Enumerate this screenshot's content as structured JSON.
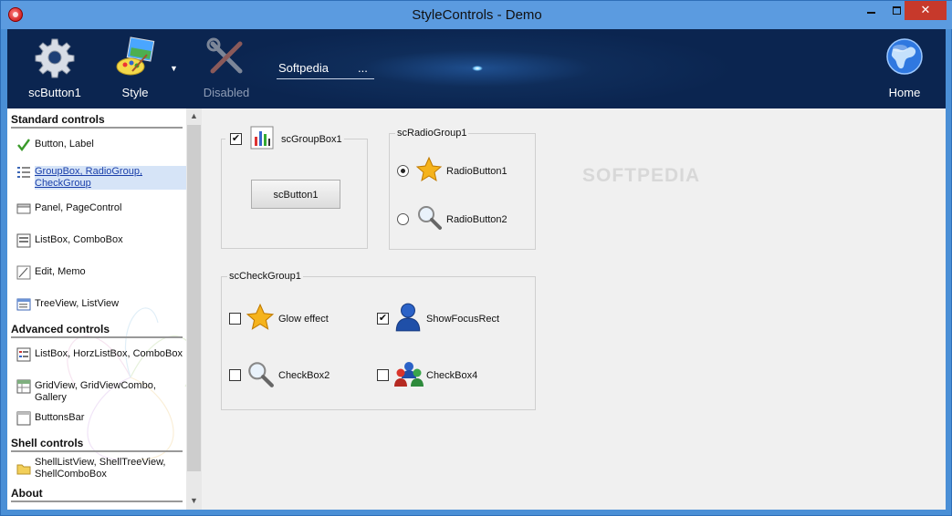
{
  "window": {
    "title": "StyleControls - Demo"
  },
  "toolbar": {
    "button1_label": "scButton1",
    "style_label": "Style",
    "disabled_label": "Disabled",
    "edit_value": "Softpedia",
    "edit_button": "...",
    "home_label": "Home"
  },
  "sidebar": {
    "standard_header": "Standard controls",
    "standard_items": [
      "Button, Label",
      "GroupBox, RadioGroup, CheckGroup",
      "Panel, PageControl",
      "ListBox, ComboBox",
      "Edit, Memo",
      "TreeView, ListView"
    ],
    "advanced_header": "Advanced controls",
    "advanced_items": [
      "ListBox, HorzListBox, ComboBox",
      "GridView, GridViewCombo, Gallery",
      "ButtonsBar"
    ],
    "shell_header": "Shell controls",
    "shell_items": [
      "ShellListView, ShellTreeView, ShellComboBox"
    ],
    "about_header": "About",
    "selected_item": "GroupBox, RadioGroup, CheckGroup"
  },
  "main": {
    "groupbox1": {
      "caption": "scGroupBox1",
      "checked": true,
      "button_label": "scButton1"
    },
    "radiogroup": {
      "caption": "scRadioGroup1",
      "items": [
        {
          "label": "RadioButton1",
          "selected": true
        },
        {
          "label": "RadioButton2",
          "selected": false
        }
      ]
    },
    "checkgroup": {
      "caption": "scCheckGroup1",
      "items": [
        {
          "label": "Glow effect",
          "checked": false
        },
        {
          "label": "ShowFocusRect",
          "checked": true
        },
        {
          "label": "CheckBox2",
          "checked": false
        },
        {
          "label": "CheckBox4",
          "checked": false
        }
      ]
    },
    "watermark": "SOFTPEDIA"
  },
  "colors": {
    "toolbar_bg": "#0b2550",
    "titlebar": "#5b9be0",
    "close_button": "#c7392b",
    "selection_link": "#1a3faa"
  },
  "icons": {
    "toolbar": [
      "gear-icon",
      "paint-palette-icon",
      "tools-icon",
      "globe-icon"
    ],
    "sidebar": [
      "checkmark-icon",
      "list-icon",
      "panel-icon",
      "listbox-icon",
      "edit-icon",
      "treeview-icon",
      "listbox-icon",
      "grid-icon",
      "buttonsbar-icon",
      "folder-icon"
    ]
  }
}
